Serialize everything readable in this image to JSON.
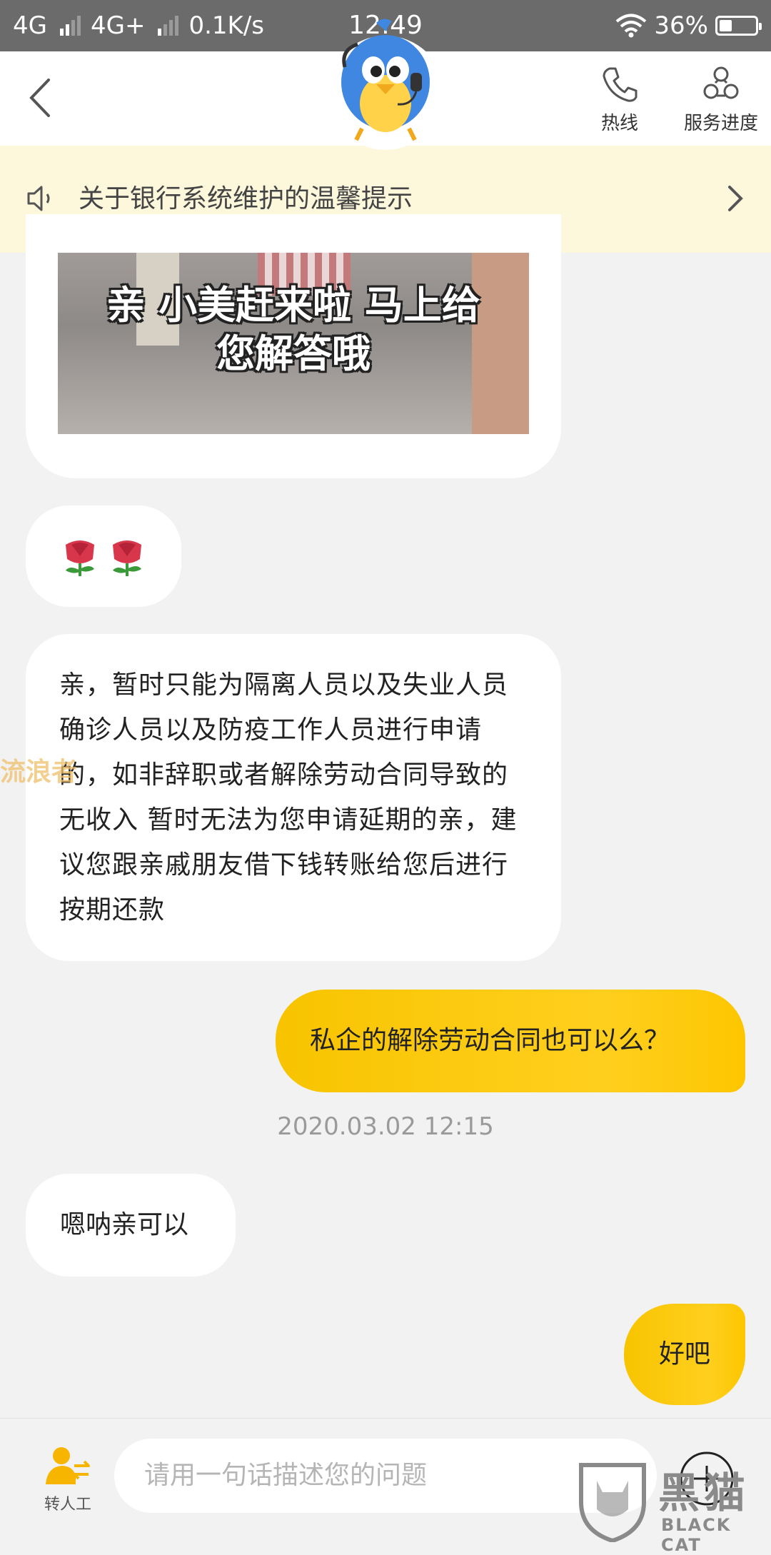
{
  "status_bar": {
    "sim1": "4G",
    "sim2": "4G+",
    "speed": "0.1K/s",
    "time": "12:49",
    "battery": "36%",
    "battery_level": 0.36
  },
  "header": {
    "hotline_label": "热线",
    "progress_label": "服务进度"
  },
  "notice": {
    "text": "关于银行系统维护的温馨提示"
  },
  "messages": {
    "gif_caption_line1": "亲 小美赶来啦 马上给",
    "gif_caption_line2": "您解答哦",
    "emoji": "🌹🌹",
    "agent_reply_1": "亲，暂时只能为隔离人员以及失业人员确诊人员以及防疫工作人员进行申请的，如非辞职或者解除劳动合同导致的无收入 暂时无法为您申请延期的亲，建议您跟亲戚朋友借下钱转账给您后进行按期还款",
    "user_msg_1": "私企的解除劳动合同也可以么？",
    "timestamp": "2020.03.02 12:15",
    "agent_reply_2": "嗯呐亲可以",
    "user_msg_2": "好吧"
  },
  "watermark_left": "流浪者",
  "bottom": {
    "transfer_label": "转人工",
    "input_placeholder": "请用一句话描述您的问题"
  },
  "watermark": {
    "cn": "黑猫",
    "en": "BLACK CAT"
  },
  "colors": {
    "accent_yellow": "#ffcb0f",
    "notice_bg": "#fdf7dc",
    "status_bar": "#6b6b6b"
  }
}
